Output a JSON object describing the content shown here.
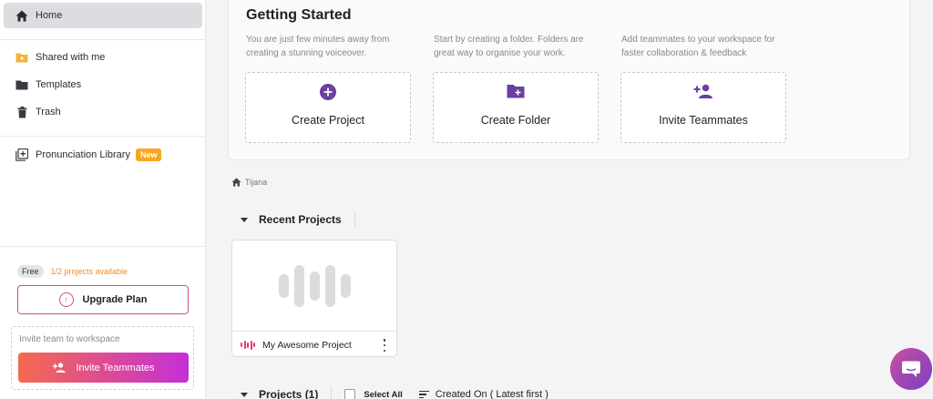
{
  "sidebar": {
    "items": [
      {
        "label": "Home",
        "icon": "home-icon"
      },
      {
        "label": "Shared with me",
        "icon": "shared-folder-icon"
      },
      {
        "label": "Templates",
        "icon": "folder-icon"
      },
      {
        "label": "Trash",
        "icon": "trash-icon"
      },
      {
        "label": "Pronunciation Library",
        "icon": "library-icon",
        "badge": "New"
      }
    ],
    "plan": {
      "tier": "Free",
      "availability": "1/2 projects available"
    },
    "upgrade_label": "Upgrade Plan",
    "invite_box_label": "Invite team to workspace",
    "invite_button_label": "Invite Teammates"
  },
  "getting_started": {
    "title": "Getting Started",
    "cards": [
      {
        "description": "You are just few minutes away from creating a stunning voiceover.",
        "label": "Create Project",
        "icon": "plus-circle-icon"
      },
      {
        "description": "Start by creating a folder. Folders are great way to organise your work.",
        "label": "Create Folder",
        "icon": "folder-plus-icon"
      },
      {
        "description": "Add teammates to your workspace for faster collaboration & feedback",
        "label": "Invite Teammates",
        "icon": "person-add-icon"
      }
    ]
  },
  "breadcrumb": {
    "label": "Tijana",
    "icon": "home-icon"
  },
  "recent": {
    "heading": "Recent Projects",
    "projects": [
      {
        "name": "My Awesome Project"
      }
    ]
  },
  "projects": {
    "heading": "Projects (1)",
    "select_all": "Select All",
    "sort_label": "Created On ( Latest first )"
  },
  "colors": {
    "accent_purple": "#6b3fa0",
    "brand_pink": "#d74a8c",
    "warning_orange": "#f08c1e"
  }
}
